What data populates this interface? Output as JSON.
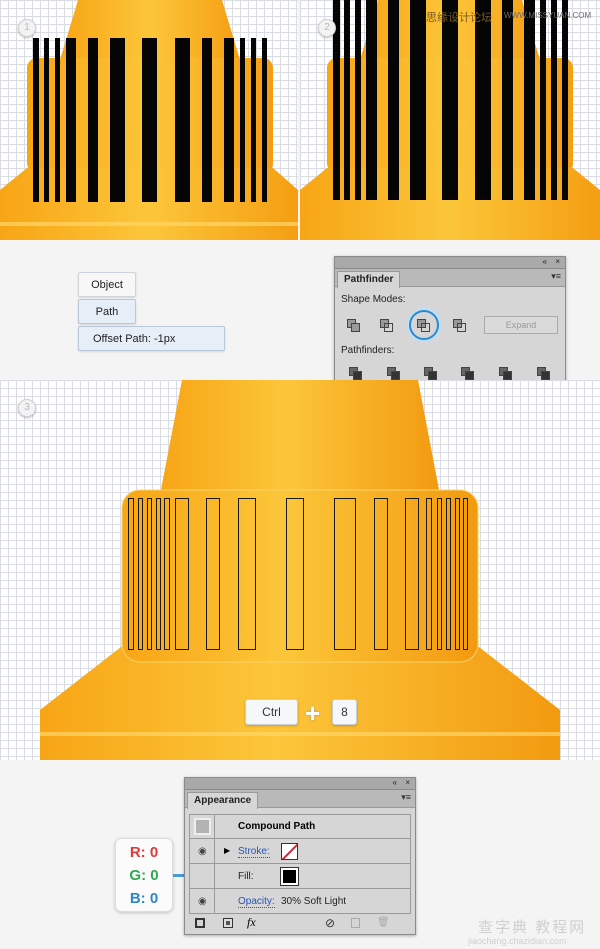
{
  "steps": [
    "1",
    "2",
    "3"
  ],
  "watermark_top": {
    "cn": "思缘设计论坛",
    "url": "WWW.MISSYUAN.COM"
  },
  "menu": {
    "object": "Object",
    "path": "Path",
    "offset": "Offset Path: -1px"
  },
  "pathfinder": {
    "tab": "Pathfinder",
    "shape_modes": "Shape Modes:",
    "expand": "Expand",
    "pathfinders": "Pathfinders:",
    "collapse_icon": "«",
    "close_icon": "×",
    "menu_icon": "▾≡"
  },
  "shortcut": {
    "key1": "Ctrl",
    "plus": "+",
    "key2": "8"
  },
  "appearance": {
    "tab": "Appearance",
    "title": "Compound Path",
    "stroke": "Stroke:",
    "fill": "Fill:",
    "opacity_label": "Opacity:",
    "opacity_value": "30% Soft Light",
    "fx": "fx"
  },
  "rgb": {
    "r": "R: 0",
    "g": "G: 0",
    "b": "B: 0"
  },
  "colors": {
    "cone": "#f9b31c",
    "r": "#e03a3a",
    "g": "#2fa84f",
    "b": "#2f86c8"
  },
  "watermark_bottom": {
    "cn": "查字典 教程网",
    "url": "jiaocheng.chazidian.com"
  }
}
